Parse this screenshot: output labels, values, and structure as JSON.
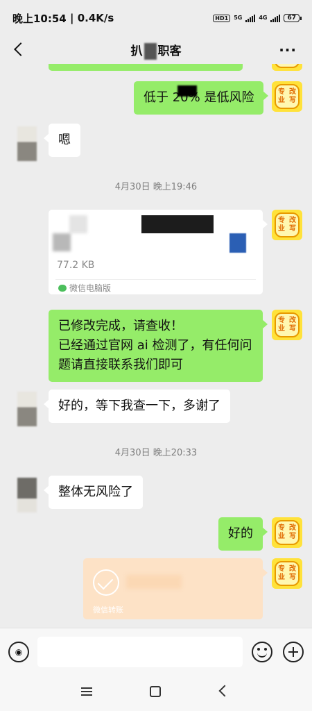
{
  "status_bar": {
    "time": "晚上10:54",
    "speed": "0.4K/s",
    "hd_label": "HD1",
    "net1": "5G",
    "net2": "4G",
    "battery": "67"
  },
  "header": {
    "title_left": "扒",
    "title_right": "职客"
  },
  "messages": {
    "m1": "低于 20% 是低风险",
    "m2": "嗯",
    "ts1": "4月30日 晚上19:46",
    "file_size": "77.2 KB",
    "file_source": "微信电脑版",
    "m3_line1": "已修改完成，请查收！",
    "m3_line2": "已经通过官网 ai 检测了，有任何问",
    "m3_line3": "题请直接联系我们即可",
    "m4": "好的，等下我查一下，多谢了",
    "ts2": "4月30日 晚上20:33",
    "m5": "整体无风险了",
    "m6": "好的",
    "transfer_label": "微信转账"
  },
  "avatar_badge": {
    "line1": "专业",
    "line2": "改写"
  },
  "colors": {
    "green_bubble": "#95ec69",
    "background": "#ededed",
    "transfer": "#fde2c6"
  },
  "icons": [
    "back-icon",
    "more-icon",
    "voice-icon",
    "emoji-icon",
    "plus-icon",
    "menu-icon",
    "home-icon",
    "nav-back-icon"
  ]
}
